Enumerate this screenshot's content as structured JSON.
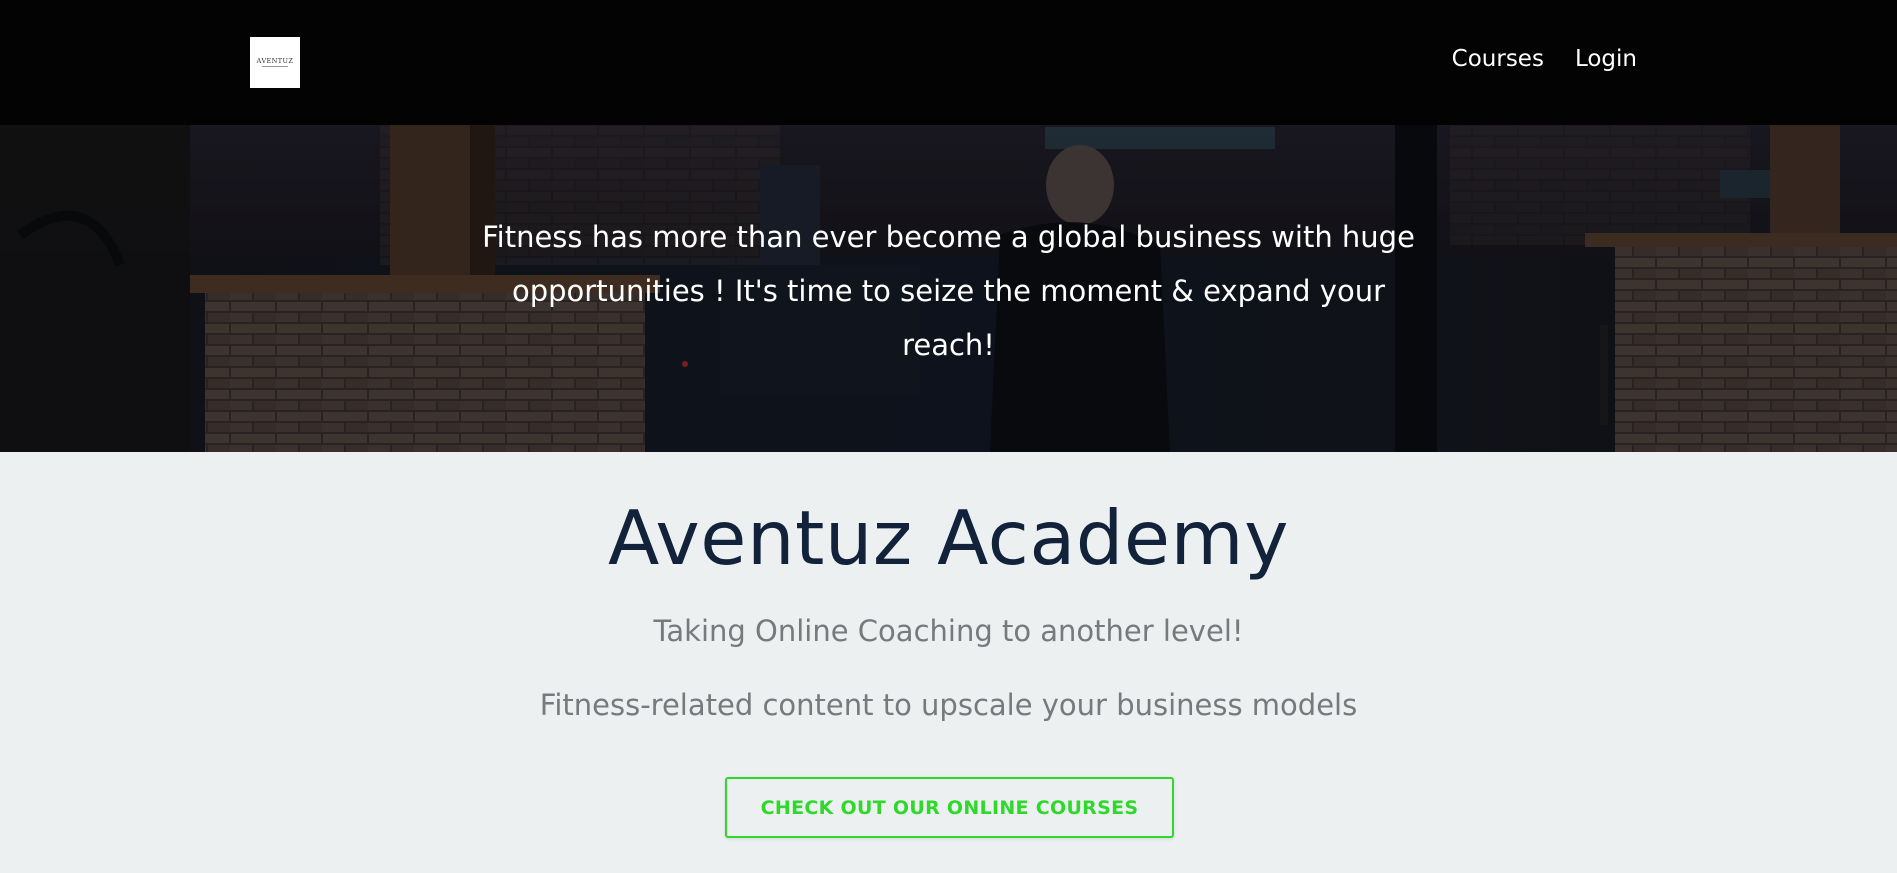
{
  "header": {
    "logo_text": "AVENTUZ",
    "nav": [
      {
        "label": "Courses"
      },
      {
        "label": "Login"
      }
    ]
  },
  "hero": {
    "text": "Fitness has more than ever become a global business with huge opportunities ! It's time to seize the moment & expand your reach!"
  },
  "main": {
    "title": "Aventuz Academy",
    "subtitle": "Taking Online Coaching to another level!",
    "tagline": "Fitness-related content to upscale your business models",
    "cta_label": "CHECK OUT OUR ONLINE COURSES"
  },
  "colors": {
    "navbar_bg": "#030304",
    "page_bg": "#ecf0f1",
    "title": "#11223a",
    "subtitle": "#77797c",
    "cta_accent": "#2fd82b"
  }
}
